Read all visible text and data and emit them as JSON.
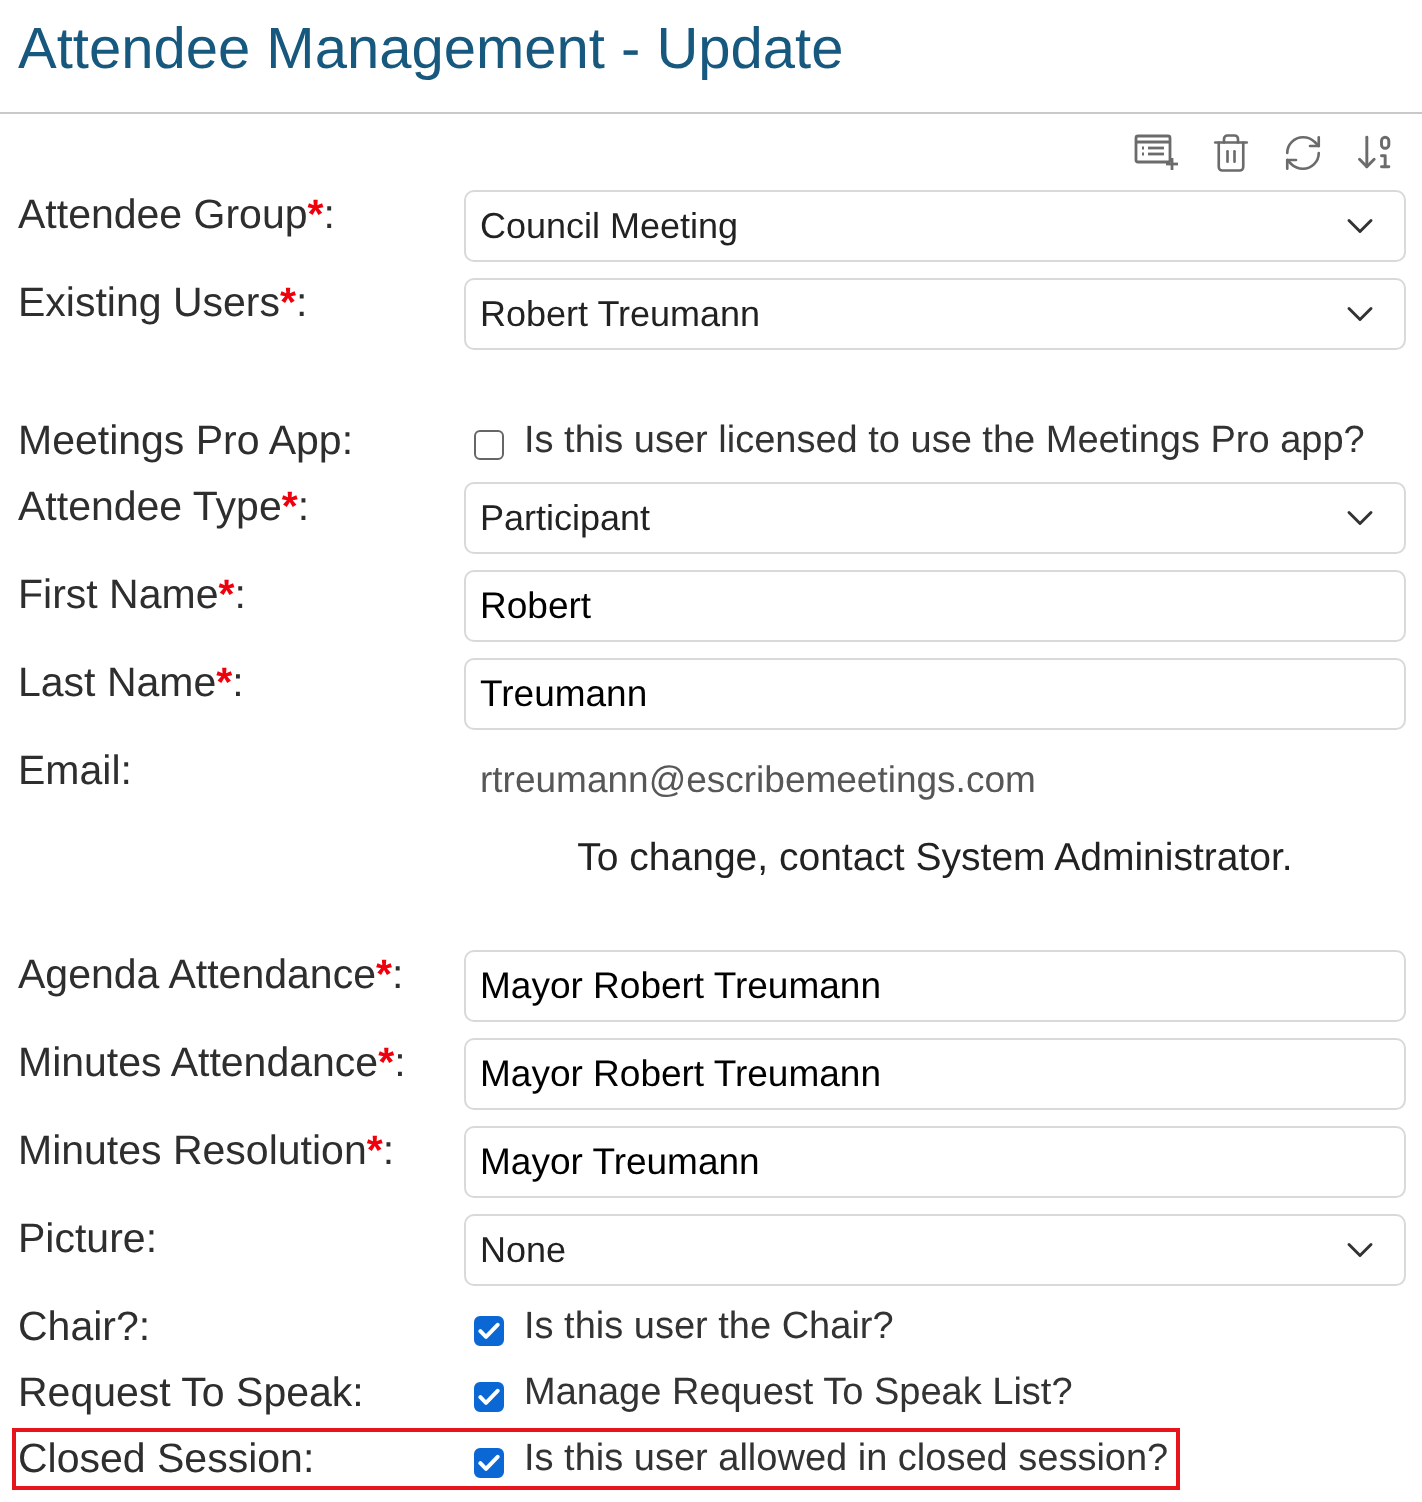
{
  "page": {
    "title": "Attendee Management - Update"
  },
  "sections": [
    {
      "rows": [
        {
          "kind": "select",
          "label": "Attendee Group",
          "required_mark": "*",
          "suffix": ":",
          "value": "Council Meeting",
          "highlighted": false
        },
        {
          "kind": "select",
          "label": "Existing Users",
          "required_mark": "*",
          "suffix": ":",
          "value": "Robert Treumann",
          "highlighted": false
        }
      ]
    },
    {
      "rows": [
        {
          "kind": "checkbox",
          "label": "Meetings Pro App",
          "suffix": ":",
          "text": "Is this user licensed to use the Meetings Pro app?",
          "checked": false,
          "highlighted": false
        },
        {
          "kind": "select",
          "label": "Attendee Type",
          "required_mark": "*",
          "suffix": ":",
          "value": "Participant",
          "highlighted": false
        },
        {
          "kind": "text",
          "label": "First Name",
          "required_mark": "*",
          "suffix": ":",
          "value": "Robert",
          "highlighted": false
        },
        {
          "kind": "text",
          "label": "Last Name",
          "required_mark": "*",
          "suffix": ":",
          "value": "Treumann",
          "highlighted": false
        },
        {
          "kind": "static",
          "label": "Email",
          "suffix": ":",
          "value": "rtreumann@escribemeetings.com",
          "note": "To change, contact System Administrator.",
          "highlighted": false
        }
      ]
    },
    {
      "rows": [
        {
          "kind": "text",
          "label": "Agenda Attendance",
          "required_mark": "*",
          "suffix": ":",
          "value": "Mayor Robert Treumann",
          "highlighted": false
        },
        {
          "kind": "text",
          "label": "Minutes Attendance",
          "required_mark": "*",
          "suffix": ":",
          "value": "Mayor Robert Treumann",
          "highlighted": false
        },
        {
          "kind": "text",
          "label": "Minutes Resolution",
          "required_mark": "*",
          "suffix": ":",
          "value": "Mayor Treumann",
          "highlighted": false
        },
        {
          "kind": "select",
          "label": "Picture",
          "suffix": ":",
          "value": "None",
          "highlighted": false
        },
        {
          "kind": "checkbox",
          "label": "Chair?",
          "suffix": ":",
          "text": "Is this user the Chair?",
          "checked": true,
          "highlighted": false
        },
        {
          "kind": "checkbox",
          "label": "Request To Speak",
          "suffix": ":",
          "text": "Manage Request To Speak List?",
          "checked": true,
          "highlighted": false
        },
        {
          "kind": "checkbox",
          "label": "Closed Session",
          "suffix": ":",
          "text": "Is this user allowed in closed session?",
          "checked": true,
          "highlighted": true
        }
      ]
    }
  ]
}
